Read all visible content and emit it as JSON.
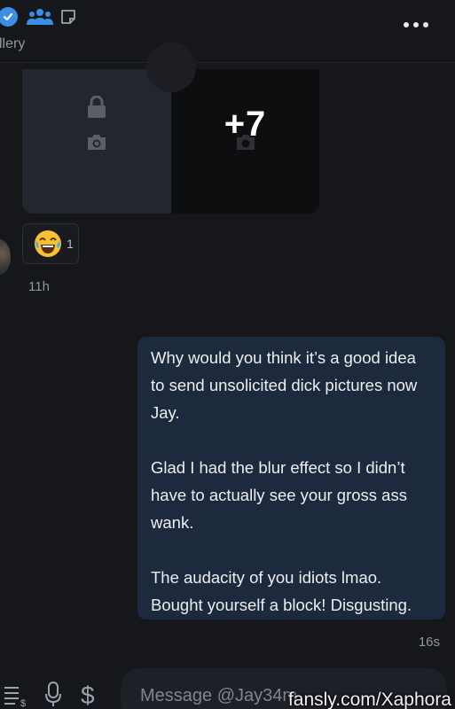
{
  "header": {
    "gallery_label": "llery",
    "icons": [
      "verified-badge-icon",
      "people-icon",
      "note-icon",
      "more-icon"
    ]
  },
  "media": {
    "more_count": "+7",
    "icons": [
      "lock-icon",
      "camera-icon"
    ]
  },
  "reaction": {
    "emoji": "😂",
    "count": "1"
  },
  "incoming": {
    "time": "11h"
  },
  "outgoing": {
    "paragraphs": [
      "Why would you think it’s a good idea to send unsolicited dick pictures now Jay.",
      "Glad I had the blur effect so I didn’t have to actually see your gross ass wank.",
      "The audacity of you idiots lmao. Bought yourself a block! Disgusting."
    ],
    "time": "16s"
  },
  "composer": {
    "placeholder": "Message @Jay34m",
    "icons": [
      "menu-dollar-icon",
      "microphone-icon",
      "dollar-icon"
    ]
  },
  "watermark": "fansly.com/Xaphora",
  "colors": {
    "accent": "#3a8ee6",
    "bubble": "#1d2a3d",
    "background": "#16171b"
  }
}
